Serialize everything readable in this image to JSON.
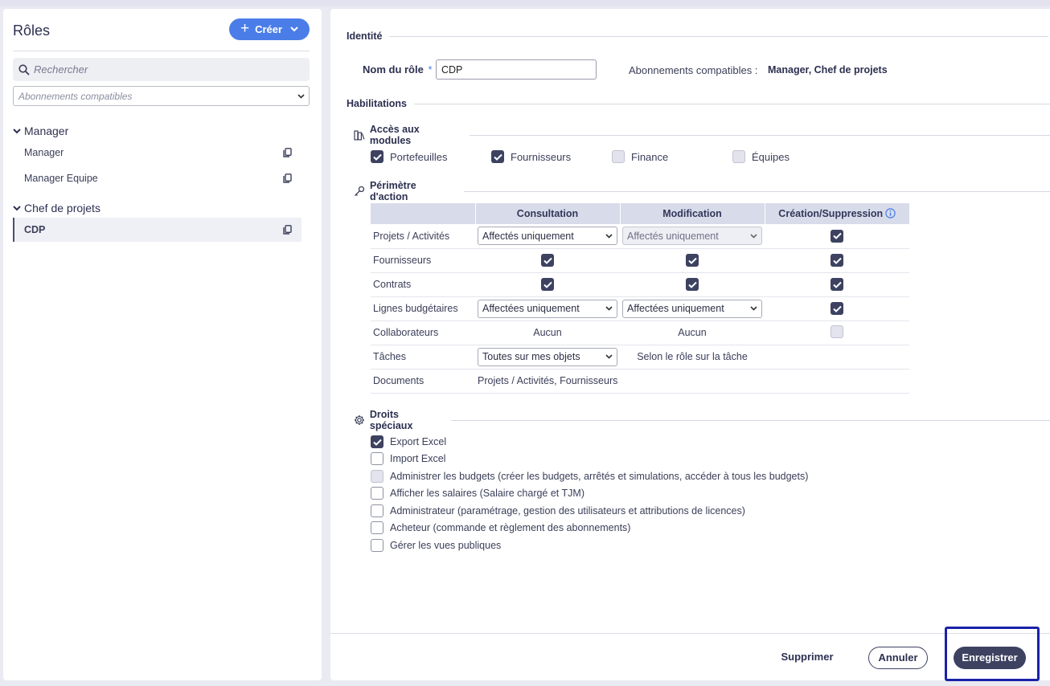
{
  "sidebar": {
    "title": "Rôles",
    "create_label": "Créer",
    "search_placeholder": "Rechercher",
    "filter_placeholder": "Abonnements compatibles",
    "groups": [
      {
        "label": "Manager",
        "items": [
          {
            "label": "Manager"
          },
          {
            "label": "Manager Equipe"
          }
        ]
      },
      {
        "label": "Chef de projets",
        "items": [
          {
            "label": "CDP"
          }
        ]
      }
    ]
  },
  "main": {
    "identity": {
      "heading": "Identité",
      "role_name_label": "Nom du rôle",
      "required_mark": "*",
      "role_name_value": "CDP",
      "subscriptions_label": "Abonnements compatibles :",
      "subscriptions_value": "Manager, Chef de projets"
    },
    "habilitations": {
      "heading": "Habilitations",
      "modules_heading": "Accès aux modules",
      "modules": [
        {
          "label": "Portefeuilles",
          "checked": true
        },
        {
          "label": "Fournisseurs",
          "checked": true
        },
        {
          "label": "Finance",
          "checked": false
        },
        {
          "label": "Équipes",
          "checked": false
        }
      ],
      "perimeter_heading": "Périmètre d'action",
      "columns": [
        "Consultation",
        "Modification",
        "Création/Suppression"
      ],
      "rows": [
        {
          "label": "Projets / Activités",
          "consultation": "Affectés uniquement",
          "modification": "Affectés uniquement"
        },
        {
          "label": "Fournisseurs"
        },
        {
          "label": "Contrats"
        },
        {
          "label": "Lignes budgétaires",
          "consultation": "Affectées uniquement",
          "modification": "Affectées uniquement"
        },
        {
          "label": "Collaborateurs",
          "consultation": "Aucun",
          "modification": "Aucun"
        },
        {
          "label": "Tâches",
          "consultation": "Toutes sur mes objets",
          "modification": "Selon le rôle sur la tâche"
        },
        {
          "label": "Documents",
          "consultation": "Projets / Activités, Fournisseurs"
        }
      ]
    },
    "special": {
      "heading": "Droits spéciaux",
      "items": [
        {
          "label": "Export Excel",
          "state": "checked"
        },
        {
          "label": "Import Excel",
          "state": "unchecked"
        },
        {
          "label": "Administrer les budgets (créer les budgets, arrêtés et simulations, accéder à tous les budgets)",
          "state": "disabled"
        },
        {
          "label": "Afficher les salaires (Salaire chargé et TJM)",
          "state": "unchecked"
        },
        {
          "label": "Administrateur (paramétrage, gestion des utilisateurs et attributions de licences)",
          "state": "unchecked"
        },
        {
          "label": "Acheteur (commande et règlement des abonnements)",
          "state": "unchecked"
        },
        {
          "label": "Gérer les vues publiques",
          "state": "unchecked"
        }
      ]
    },
    "footer": {
      "delete_label": "Supprimer",
      "cancel_label": "Annuler",
      "save_label": "Enregistrer"
    }
  },
  "colors": {
    "accent": "#4a7de8",
    "primary_dark": "#3e4261",
    "table_header": "#d8dbe9",
    "highlight_box": "#1a22a8"
  },
  "icons": [
    "plus-icon",
    "chevron-down-icon",
    "search-icon",
    "copy-icon",
    "modules-icon",
    "key-icon",
    "gear-icon",
    "info-icon",
    "check-icon"
  ]
}
